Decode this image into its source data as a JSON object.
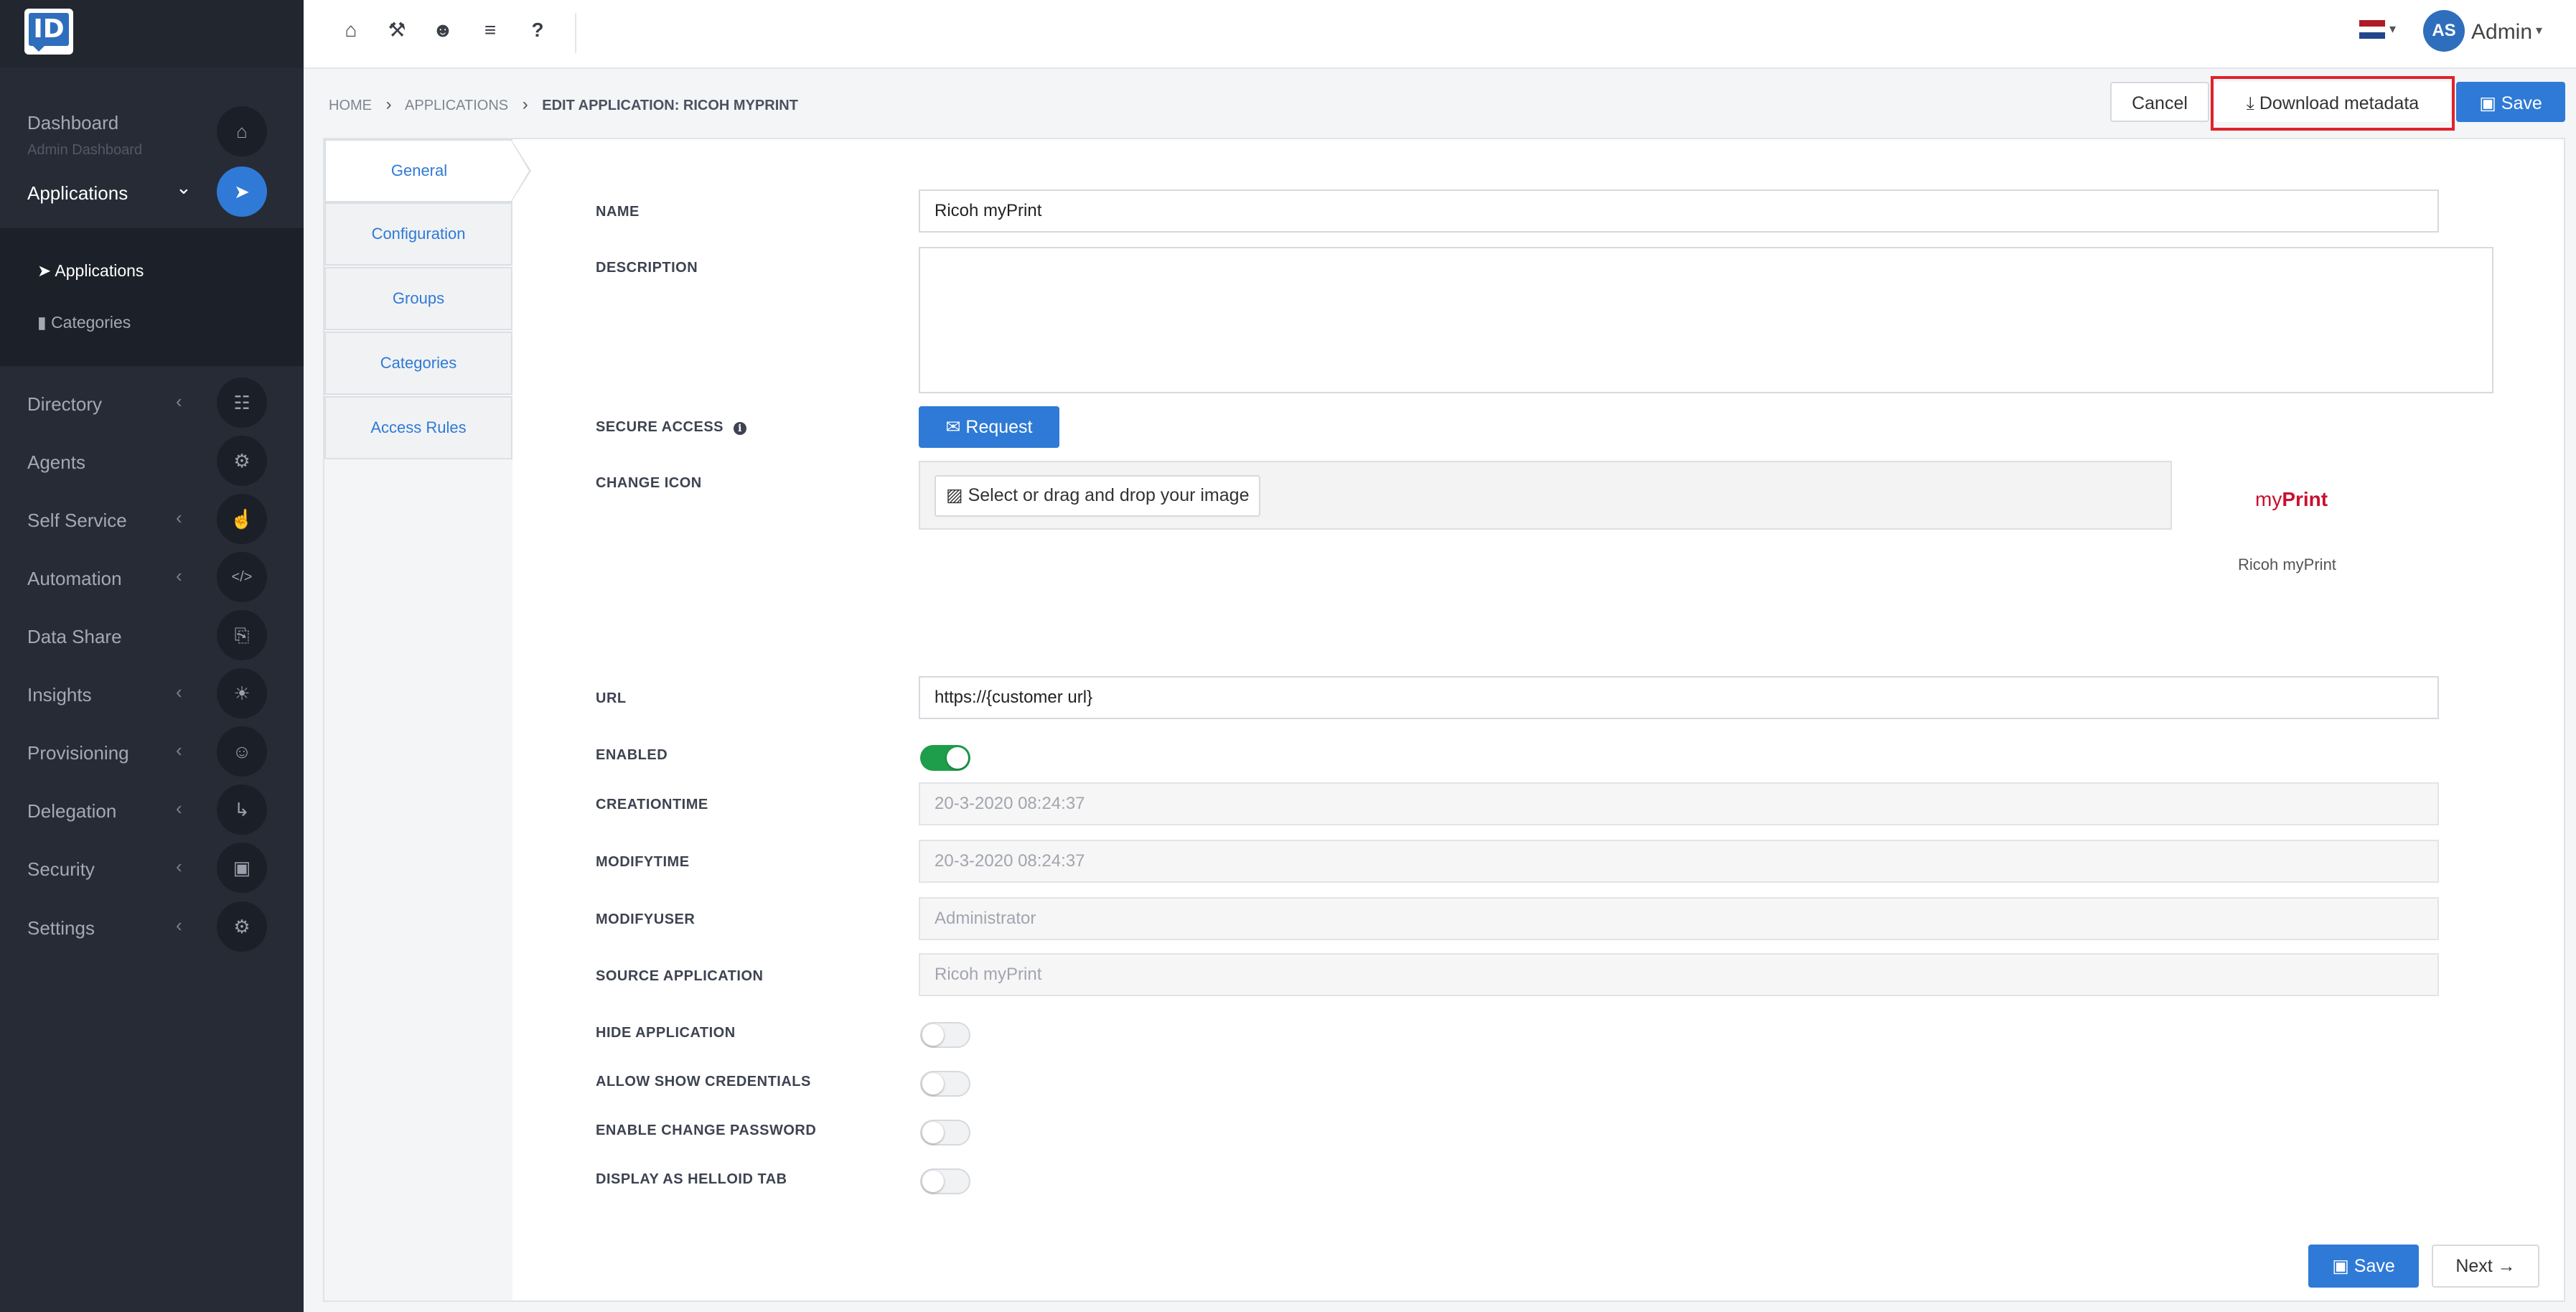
{
  "sidebar": {
    "logo_text": "ID",
    "items": [
      {
        "label": "Dashboard",
        "sub": "Admin Dashboard",
        "icon": "⌂"
      },
      {
        "label": "Applications",
        "icon": "➤"
      },
      {
        "label": "Directory",
        "icon": "☷"
      },
      {
        "label": "Agents",
        "icon": "⚙"
      },
      {
        "label": "Self Service",
        "icon": "☝"
      },
      {
        "label": "Automation",
        "icon": "</>"
      },
      {
        "label": "Data Share",
        "icon": "⎘"
      },
      {
        "label": "Insights",
        "icon": "☀"
      },
      {
        "label": "Provisioning",
        "icon": "☺"
      },
      {
        "label": "Delegation",
        "icon": "↳"
      },
      {
        "label": "Security",
        "icon": "▣"
      },
      {
        "label": "Settings",
        "icon": "⚙"
      }
    ],
    "sub_items": [
      {
        "label": "Applications",
        "icon": "➤"
      },
      {
        "label": "Categories",
        "icon": "▮"
      }
    ],
    "chevron": "‹",
    "chevron_open": "⌄"
  },
  "topbar": {
    "icons": [
      "⌂",
      "⚒",
      "☻",
      "≡",
      "?"
    ],
    "avatar_initials": "AS",
    "user_name": "Admin",
    "caret": "▾",
    "flag_colors": [
      "#ae1c28",
      "#ffffff",
      "#21468b"
    ]
  },
  "breadcrumb": {
    "home": "HOME",
    "applications": "APPLICATIONS",
    "current": "EDIT APPLICATION: RICOH MYPRINT",
    "sep": "›"
  },
  "actions": {
    "cancel": "Cancel",
    "download": "Download metadata",
    "download_icon": "⤓",
    "save": "Save",
    "save_icon": "▣",
    "next": "Next",
    "next_icon": "→"
  },
  "tabs": [
    "General",
    "Configuration",
    "Groups",
    "Categories",
    "Access Rules"
  ],
  "form": {
    "name_label": "NAME",
    "name_value": "Ricoh myPrint",
    "description_label": "DESCRIPTION",
    "secure_access_label": "SECURE ACCESS",
    "info_icon": "i",
    "request_button": "Request",
    "request_icon": "✉",
    "change_icon_label": "CHANGE ICON",
    "dropzone_button": "Select or drag and drop your image",
    "dropzone_icon": "▨",
    "preview_logo_a": "my",
    "preview_logo_b": "Print",
    "preview_name": "Ricoh myPrint",
    "url_label": "URL",
    "url_value": "https://{customer url}",
    "enabled_label": "ENABLED",
    "enabled": true,
    "creationtime_label": "CREATIONTIME",
    "creationtime_value": "20-3-2020 08:24:37",
    "modifytime_label": "MODIFYTIME",
    "modifytime_value": "20-3-2020 08:24:37",
    "modifyuser_label": "MODIFYUSER",
    "modifyuser_value": "Administrator",
    "source_app_label": "SOURCE APPLICATION",
    "source_app_value": "Ricoh myPrint",
    "hide_app_label": "HIDE APPLICATION",
    "hide_app": false,
    "allow_creds_label": "ALLOW SHOW CREDENTIALS",
    "allow_creds": false,
    "change_pw_label": "ENABLE CHANGE PASSWORD",
    "change_pw": false,
    "helloid_tab_label": "DISPLAY AS HELLOID TAB",
    "helloid_tab": false
  },
  "colors": {
    "accent": "#2f7ad6",
    "sidebar_bg": "#262b36",
    "toggle_on": "#1e9e4a",
    "highlight": "#e0222a"
  }
}
